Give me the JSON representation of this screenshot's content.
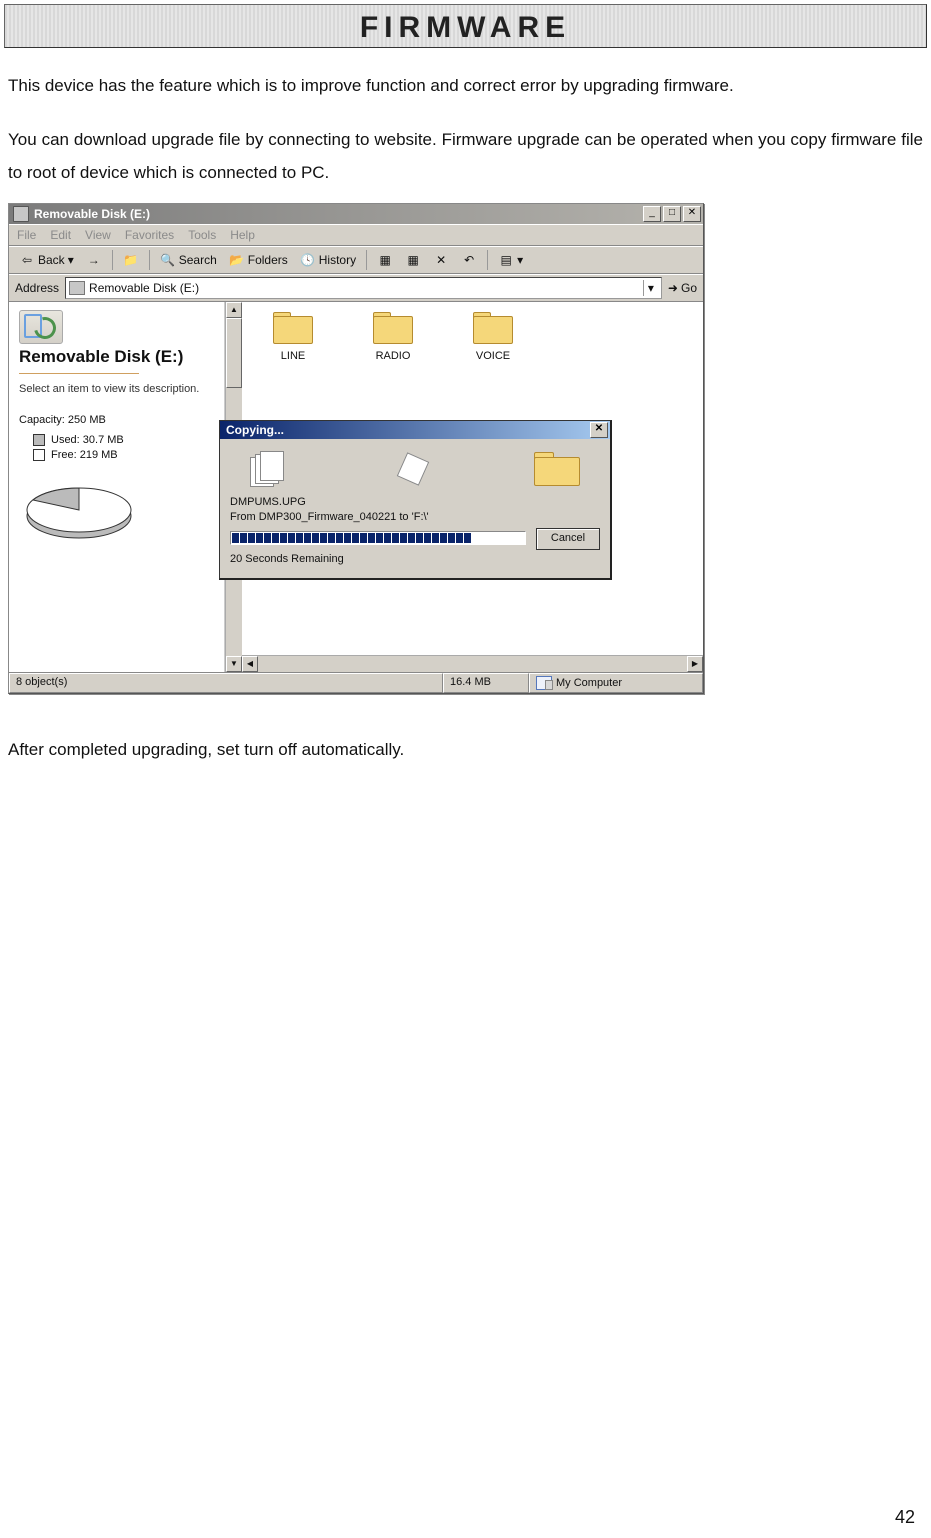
{
  "document": {
    "title": "FIRMWARE",
    "para1": "This device has the feature which is to improve function and correct error by upgrading firmware.",
    "para2": "You can download upgrade file by connecting to website. Firmware upgrade can be operated when you copy firmware file to root of device which is connected to PC.",
    "para3": "After completed upgrading, set turn off automatically.",
    "page_number": "42"
  },
  "explorer": {
    "window_title": "Removable Disk (E:)",
    "menu": {
      "file": "File",
      "edit": "Edit",
      "view": "View",
      "favorites": "Favorites",
      "tools": "Tools",
      "help": "Help"
    },
    "toolbar": {
      "back": "Back",
      "search": "Search",
      "folders": "Folders",
      "history": "History"
    },
    "address_label": "Address",
    "address_value": "Removable Disk (E:)",
    "go_label": "Go",
    "sidebar": {
      "title": "Removable Disk (E:)",
      "desc": "Select an item to view its description.",
      "capacity": "Capacity: 250 MB",
      "used": "Used: 30.7 MB",
      "free": "Free: 219 MB"
    },
    "folders": [
      "LINE",
      "RADIO",
      "VOICE"
    ],
    "status": {
      "objects": "8 object(s)",
      "size": "16.4 MB",
      "location": "My Computer"
    }
  },
  "copy_dialog": {
    "title": "Copying...",
    "filename": "DMPUMS.UPG",
    "from_prefix": "From",
    "from_path": "DMP300_Firmware_040221",
    "to_prefix": "to",
    "to_path": "'F:\\'",
    "remaining": "20 Seconds Remaining",
    "cancel": "Cancel"
  }
}
